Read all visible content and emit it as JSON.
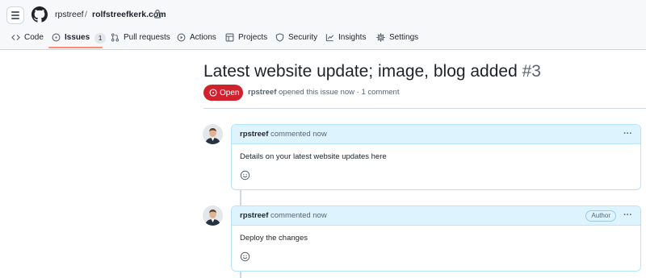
{
  "header": {
    "owner": "rpstreef",
    "separator": "/",
    "repo": "rolfstreefkerk.com"
  },
  "tabs": [
    {
      "label": "Code",
      "icon": "code-icon"
    },
    {
      "label": "Issues",
      "icon": "issue-opened-icon",
      "count": "1",
      "active": true
    },
    {
      "label": "Pull requests",
      "icon": "git-pull-request-icon"
    },
    {
      "label": "Actions",
      "icon": "play-icon"
    },
    {
      "label": "Projects",
      "icon": "table-icon"
    },
    {
      "label": "Security",
      "icon": "shield-icon"
    },
    {
      "label": "Insights",
      "icon": "graph-icon"
    },
    {
      "label": "Settings",
      "icon": "gear-icon"
    }
  ],
  "issue": {
    "title": "Latest website update; image, blog added",
    "number": "#3",
    "state": "Open",
    "author": "rpstreef",
    "meta_text": "opened this issue now · 1 comment",
    "state_color": "#cf222e"
  },
  "comments": [
    {
      "author": "rpstreef",
      "time": "commented now",
      "body": "Details on your latest website updates here",
      "label": "",
      "menu": "···"
    },
    {
      "author": "rpstreef",
      "time": "commented now",
      "body": "Deploy the changes",
      "label": "Author",
      "menu": "···"
    }
  ],
  "colors": {
    "accent_underline": "#fd8c73",
    "comment_header_bg": "#ddf4ff",
    "comment_border": "#b6e3ff"
  }
}
